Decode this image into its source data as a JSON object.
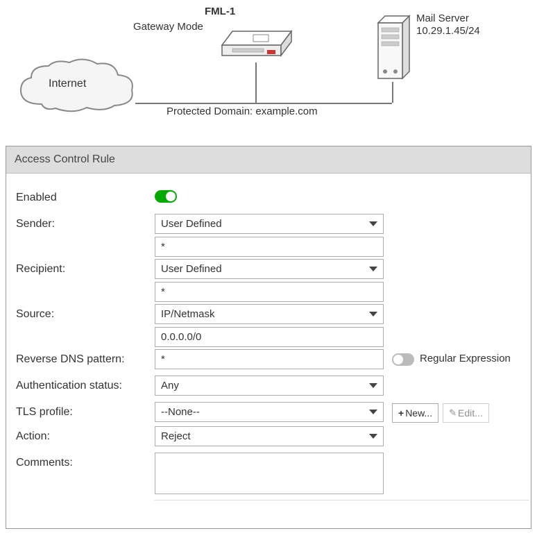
{
  "diagram": {
    "fml_name": "FML-1",
    "fml_mode": "Gateway Mode",
    "internet": "Internet",
    "server_name": "Mail Server",
    "server_ip": "10.29.1.45/24",
    "protected_domain": "Protected Domain: example.com"
  },
  "panel": {
    "title": "Access Control Rule",
    "fields": {
      "enabled": {
        "label": "Enabled",
        "value": true
      },
      "sender": {
        "label": "Sender:",
        "select": "User Defined",
        "value": "*"
      },
      "recipient": {
        "label": "Recipient:",
        "select": "User Defined",
        "value": "*"
      },
      "source": {
        "label": "Source:",
        "select": "IP/Netmask",
        "value": "0.0.0.0/0"
      },
      "rdns": {
        "label": "Reverse DNS pattern:",
        "value": "*",
        "regex_label": "Regular Expression",
        "regex_on": false
      },
      "auth": {
        "label": "Authentication status:",
        "select": "Any"
      },
      "tls": {
        "label": "TLS profile:",
        "select": "--None--",
        "new_btn": "New...",
        "edit_btn": "Edit..."
      },
      "action": {
        "label": "Action:",
        "select": "Reject"
      },
      "comments": {
        "label": "Comments:",
        "value": ""
      }
    }
  }
}
